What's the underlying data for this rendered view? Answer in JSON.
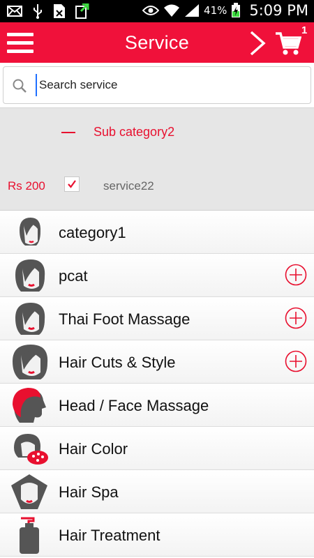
{
  "status_bar": {
    "battery_pct": "41%",
    "time": "5:09 PM",
    "icons": [
      "email-icon",
      "usb-icon",
      "sim-icon",
      "download-icon",
      "eye-icon",
      "wifi-icon",
      "signal-icon",
      "battery-icon"
    ]
  },
  "toolbar": {
    "title": "Service",
    "cart_count": "1",
    "bg_color": "#f0113a"
  },
  "search": {
    "placeholder": "Search service"
  },
  "subcategory": {
    "label": "Sub category2"
  },
  "service": {
    "price": "Rs 200",
    "name": "service22",
    "checked": true
  },
  "categories": [
    {
      "label": "category1",
      "icon": "woman-head-icon",
      "expandable": false
    },
    {
      "label": "pcat",
      "icon": "woman-head-icon",
      "expandable": true
    },
    {
      "label": "Thai Foot Massage",
      "icon": "woman-head-icon",
      "expandable": true
    },
    {
      "label": "Hair Cuts & Style",
      "icon": "woman-head-icon",
      "expandable": true
    },
    {
      "label": "Head / Face Massage",
      "icon": "head-massage-icon",
      "expandable": false
    },
    {
      "label": "Hair Color",
      "icon": "hair-color-icon",
      "expandable": false
    },
    {
      "label": "Hair Spa",
      "icon": "hair-spa-icon",
      "expandable": false
    },
    {
      "label": "Hair Treatment",
      "icon": "bottle-icon",
      "expandable": false
    }
  ]
}
